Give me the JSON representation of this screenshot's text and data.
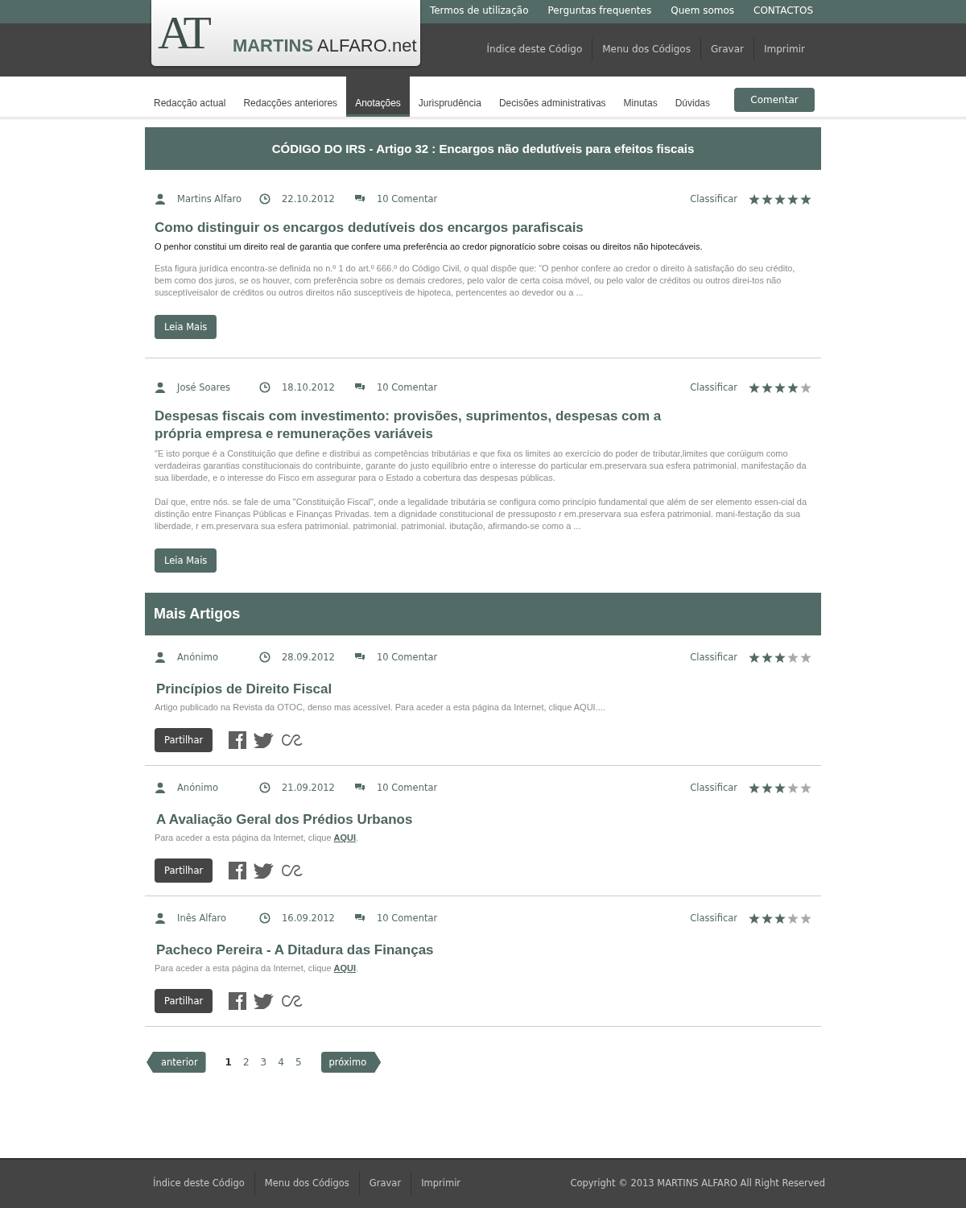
{
  "logo": {
    "mark": "AT",
    "name": "**MARTINS** ALFARO.net"
  },
  "top_links": [
    "Termos de utilização",
    "Perguntas frequentes",
    "Quem somos",
    "CONTACTOS"
  ],
  "toolbar_links": [
    "Índice deste Código",
    "Menu dos Códigos",
    "Gravar",
    "Imprimir"
  ],
  "tabs": [
    {
      "label": "Redacção actual",
      "selected": false
    },
    {
      "label": "Redacções anteriores",
      "selected": false
    },
    {
      "label": "Anotações",
      "selected": true
    },
    {
      "label": "Jurisprudência",
      "selected": false
    },
    {
      "label": "Decisões administrativas",
      "selected": false
    },
    {
      "label": "Minutas",
      "selected": false
    },
    {
      "label": "Dúvidas",
      "selected": false
    }
  ],
  "comment_button": "Comentar",
  "page_title": "CÓDIGO DO IRS - Artigo 32 : Encargos não dedutíveis para efeitos fiscais",
  "articles": [
    {
      "author": "Martins Alfaro",
      "date": "22.10.2012",
      "comments": "10 Comentar",
      "rating_label": "Classificar",
      "stars": 5,
      "title": "Como distinguir os encargos dedutíveis dos encargos parafiscais",
      "lead": "O penhor constitui um direito real de garantia que confere uma preferência ao credor pignoratício sobre coisas ou direitos não hipotecáveis.",
      "paragraphs": [
        "Esta figura jurídica encontra-se definida no n.º 1 do art.º 666.º do Código Civil, o qual dispõe que: “O penhor confere ao credor o direito à satisfação do seu crédito, bem como dos juros, se os houver, com preferência sobre os demais credores, pelo valor de certa coisa móvel, ou pelo valor de créditos ou outros direi-tos não susceptíveisalor de créditos ou outros direitos não susceptíveis de hipoteca, pertencentes ao devedor ou a ..."
      ],
      "button": "Leia Mais"
    },
    {
      "author": "José Soares",
      "date": "18.10.2012",
      "comments": "10 Comentar",
      "rating_label": "Classificar",
      "stars": 4,
      "title": "Despesas fiscais com investimento: provisões, suprimentos, despesas com a própria empresa e remunerações variáveis",
      "paragraphs": [
        "\"E isto porque é a Constituição que define e distribui as competências tributárias e que fixa os limites ao exercício do poder de tributar,limites que corúigum como verdadeiras garantias constitucionais do contribuinte, garante do justo equilíbrio entre o interesse do particular em.preservara sua esfera patrimonial. manifestação da sua liberdade, e o interesse do Fisco em assegurar para o Estado a cobertura das despesas públicas.",
        "Daí que, entre nós. se fale de uma \"Constituição Fiscal\", onde a legalidade tributária se configura como princípio fundamental que além de ser elemento essen-cial da distinção entre Finanças Públicas e Finanças Privadas. tem a dignidade constitucional de pressuposto r em.preservara sua esfera patrimonial. mani-festação da sua liberdade, r em.preservara sua esfera patrimonial. patrimonial. patrimonial. ibutação, afirmando-se como a ..."
      ],
      "button": "Leia Mais"
    }
  ],
  "more_title": "Mais Artigos",
  "more_articles": [
    {
      "author": "Anónimo",
      "date": "28.09.2012",
      "comments": "10 Comentar",
      "rating_label": "Classificar",
      "stars": 3,
      "title": "Princípios de Direito Fiscal",
      "summary": "Artigo publicado na Revista da OTOC, denso mas acessível. Para aceder a esta página da Internet, clique AQUI....",
      "button": "Partilhar"
    },
    {
      "author": "Anónimo",
      "date": "21.09.2012",
      "comments": "10 Comentar",
      "rating_label": "Classificar",
      "stars": 3,
      "title": "A Avaliação Geral dos Prédios Urbanos",
      "summary": "Para aceder a esta página da Internet, clique",
      "link": "AQUI",
      "after": ".",
      "button": "Partilhar"
    },
    {
      "author": "Inês Alfaro",
      "date": "16.09.2012",
      "comments": "10 Comentar",
      "rating_label": "Classificar",
      "stars": 3,
      "title": "Pacheco Pereira - A Ditadura das Finanças",
      "summary": "Para aceder a esta página da Internet, clique",
      "link": "AQUI",
      "after": ".",
      "button": "Partilhar"
    }
  ],
  "pagination": {
    "previous": "anterior",
    "pages": [
      {
        "label": "1",
        "selected": true
      },
      {
        "label": "2",
        "selected": false
      },
      {
        "label": "3",
        "selected": false
      },
      {
        "label": "4",
        "selected": false
      },
      {
        "label": "5",
        "selected": false
      }
    ],
    "next": "próximo"
  },
  "footer": {
    "links": [
      "Índice deste Código",
      "Menu dos Códigos",
      "Gravar",
      "Imprimir"
    ],
    "copyright": "Copyright © 2013 MARTINS ALFARO All Right Reserved"
  }
}
